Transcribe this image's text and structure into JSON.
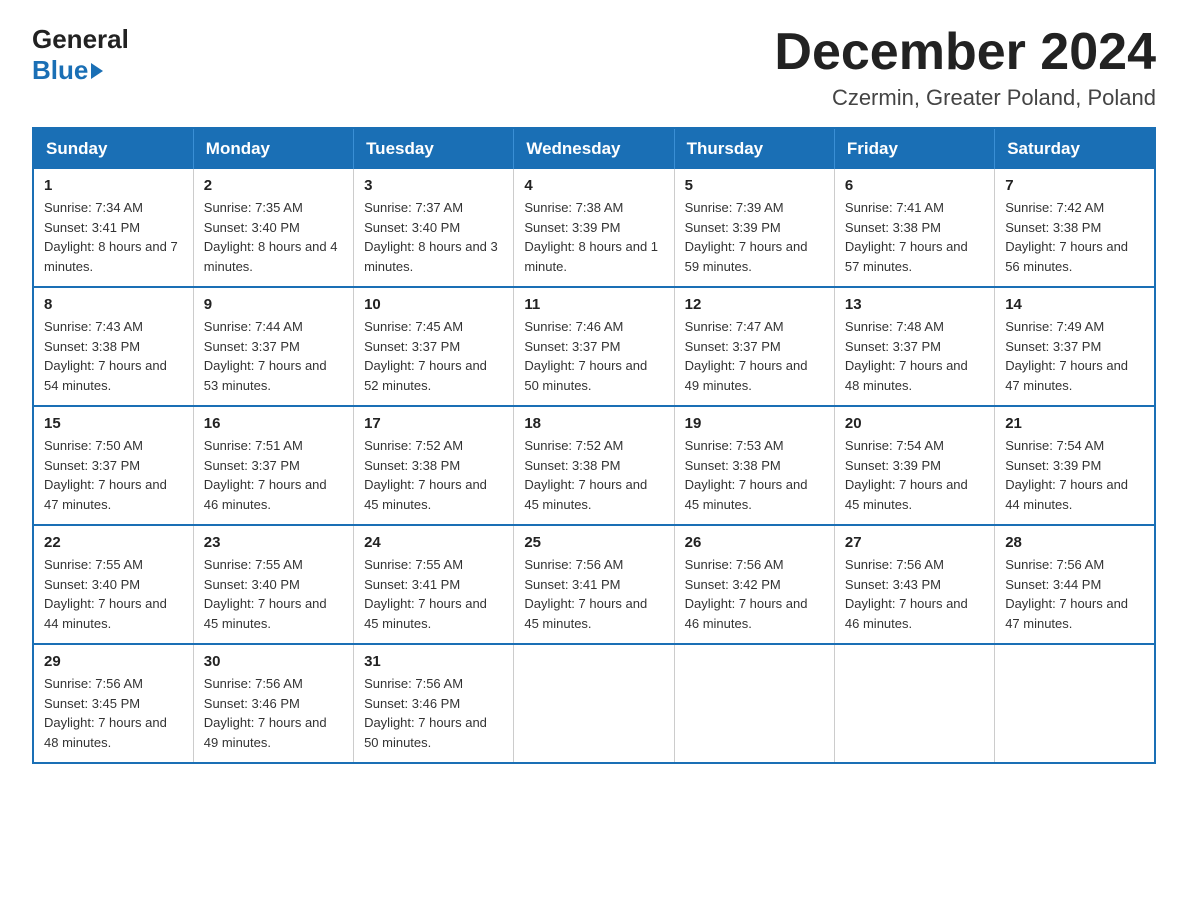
{
  "header": {
    "logo_general": "General",
    "logo_blue": "Blue",
    "month_title": "December 2024",
    "location": "Czermin, Greater Poland, Poland"
  },
  "days_of_week": [
    "Sunday",
    "Monday",
    "Tuesday",
    "Wednesday",
    "Thursday",
    "Friday",
    "Saturday"
  ],
  "weeks": [
    [
      {
        "day": "1",
        "sunrise": "7:34 AM",
        "sunset": "3:41 PM",
        "daylight": "8 hours and 7 minutes."
      },
      {
        "day": "2",
        "sunrise": "7:35 AM",
        "sunset": "3:40 PM",
        "daylight": "8 hours and 4 minutes."
      },
      {
        "day": "3",
        "sunrise": "7:37 AM",
        "sunset": "3:40 PM",
        "daylight": "8 hours and 3 minutes."
      },
      {
        "day": "4",
        "sunrise": "7:38 AM",
        "sunset": "3:39 PM",
        "daylight": "8 hours and 1 minute."
      },
      {
        "day": "5",
        "sunrise": "7:39 AM",
        "sunset": "3:39 PM",
        "daylight": "7 hours and 59 minutes."
      },
      {
        "day": "6",
        "sunrise": "7:41 AM",
        "sunset": "3:38 PM",
        "daylight": "7 hours and 57 minutes."
      },
      {
        "day": "7",
        "sunrise": "7:42 AM",
        "sunset": "3:38 PM",
        "daylight": "7 hours and 56 minutes."
      }
    ],
    [
      {
        "day": "8",
        "sunrise": "7:43 AM",
        "sunset": "3:38 PM",
        "daylight": "7 hours and 54 minutes."
      },
      {
        "day": "9",
        "sunrise": "7:44 AM",
        "sunset": "3:37 PM",
        "daylight": "7 hours and 53 minutes."
      },
      {
        "day": "10",
        "sunrise": "7:45 AM",
        "sunset": "3:37 PM",
        "daylight": "7 hours and 52 minutes."
      },
      {
        "day": "11",
        "sunrise": "7:46 AM",
        "sunset": "3:37 PM",
        "daylight": "7 hours and 50 minutes."
      },
      {
        "day": "12",
        "sunrise": "7:47 AM",
        "sunset": "3:37 PM",
        "daylight": "7 hours and 49 minutes."
      },
      {
        "day": "13",
        "sunrise": "7:48 AM",
        "sunset": "3:37 PM",
        "daylight": "7 hours and 48 minutes."
      },
      {
        "day": "14",
        "sunrise": "7:49 AM",
        "sunset": "3:37 PM",
        "daylight": "7 hours and 47 minutes."
      }
    ],
    [
      {
        "day": "15",
        "sunrise": "7:50 AM",
        "sunset": "3:37 PM",
        "daylight": "7 hours and 47 minutes."
      },
      {
        "day": "16",
        "sunrise": "7:51 AM",
        "sunset": "3:37 PM",
        "daylight": "7 hours and 46 minutes."
      },
      {
        "day": "17",
        "sunrise": "7:52 AM",
        "sunset": "3:38 PM",
        "daylight": "7 hours and 45 minutes."
      },
      {
        "day": "18",
        "sunrise": "7:52 AM",
        "sunset": "3:38 PM",
        "daylight": "7 hours and 45 minutes."
      },
      {
        "day": "19",
        "sunrise": "7:53 AM",
        "sunset": "3:38 PM",
        "daylight": "7 hours and 45 minutes."
      },
      {
        "day": "20",
        "sunrise": "7:54 AM",
        "sunset": "3:39 PM",
        "daylight": "7 hours and 45 minutes."
      },
      {
        "day": "21",
        "sunrise": "7:54 AM",
        "sunset": "3:39 PM",
        "daylight": "7 hours and 44 minutes."
      }
    ],
    [
      {
        "day": "22",
        "sunrise": "7:55 AM",
        "sunset": "3:40 PM",
        "daylight": "7 hours and 44 minutes."
      },
      {
        "day": "23",
        "sunrise": "7:55 AM",
        "sunset": "3:40 PM",
        "daylight": "7 hours and 45 minutes."
      },
      {
        "day": "24",
        "sunrise": "7:55 AM",
        "sunset": "3:41 PM",
        "daylight": "7 hours and 45 minutes."
      },
      {
        "day": "25",
        "sunrise": "7:56 AM",
        "sunset": "3:41 PM",
        "daylight": "7 hours and 45 minutes."
      },
      {
        "day": "26",
        "sunrise": "7:56 AM",
        "sunset": "3:42 PM",
        "daylight": "7 hours and 46 minutes."
      },
      {
        "day": "27",
        "sunrise": "7:56 AM",
        "sunset": "3:43 PM",
        "daylight": "7 hours and 46 minutes."
      },
      {
        "day": "28",
        "sunrise": "7:56 AM",
        "sunset": "3:44 PM",
        "daylight": "7 hours and 47 minutes."
      }
    ],
    [
      {
        "day": "29",
        "sunrise": "7:56 AM",
        "sunset": "3:45 PM",
        "daylight": "7 hours and 48 minutes."
      },
      {
        "day": "30",
        "sunrise": "7:56 AM",
        "sunset": "3:46 PM",
        "daylight": "7 hours and 49 minutes."
      },
      {
        "day": "31",
        "sunrise": "7:56 AM",
        "sunset": "3:46 PM",
        "daylight": "7 hours and 50 minutes."
      },
      null,
      null,
      null,
      null
    ]
  ]
}
